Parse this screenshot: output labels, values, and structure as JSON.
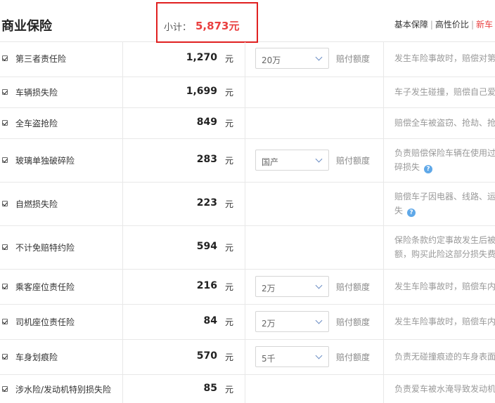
{
  "header": {
    "title": "商业保险",
    "subtotal_label": "小计：",
    "subtotal_value": "5,873元",
    "packages": [
      "基本保障",
      "高性价比",
      "新车"
    ]
  },
  "unit": "元",
  "limit_label": "赔付额度",
  "rows": [
    {
      "name": "第三者责任险",
      "price": "1,270",
      "select": "20万",
      "desc": [
        "发生车险事故时，赔偿对第"
      ]
    },
    {
      "name": "车辆损失险",
      "price": "1,699",
      "select": null,
      "desc": [
        "车子发生碰撞，赔偿自己爱"
      ]
    },
    {
      "name": "全车盗抢险",
      "price": "849",
      "select": null,
      "desc": [
        "赔偿全车被盗窃、抢劫、抢"
      ]
    },
    {
      "name": "玻璃单独破碎险",
      "price": "283",
      "select": "国产",
      "desc": [
        "负责赔偿保险车辆在使用过",
        "碎损失"
      ],
      "help": true
    },
    {
      "name": "自燃损失险",
      "price": "223",
      "select": null,
      "desc": [
        "赔偿车子因电器、线路、运",
        "失"
      ],
      "help": true
    },
    {
      "name": "不计免赔特约险",
      "price": "594",
      "select": null,
      "desc": [
        "保险条款约定事故发生后被",
        "额，购买此险这部分损失费"
      ]
    },
    {
      "name": "乘客座位责任险",
      "price": "216",
      "select": "2万",
      "desc": [
        "发生车险事故时，赔偿车内"
      ]
    },
    {
      "name": "司机座位责任险",
      "price": "84",
      "select": "2万",
      "desc": [
        "发生车险事故时，赔偿车内"
      ]
    },
    {
      "name": "车身划痕险",
      "price": "570",
      "select": "5千",
      "desc": [
        "负责无碰撞痕迹的车身表面"
      ]
    },
    {
      "name": "涉水险/发动机特别损失险",
      "price": "85",
      "select": null,
      "desc": [
        "负责爱车被水淹导致发动机"
      ]
    }
  ],
  "icons": {
    "checkbox": "checkmark-icon",
    "dropdown": "chevron-down-icon",
    "help": "question-mark-icon"
  },
  "colors": {
    "accent_red": "#e94040",
    "box_border": "#e02020",
    "help_blue": "#5fa8e8"
  }
}
